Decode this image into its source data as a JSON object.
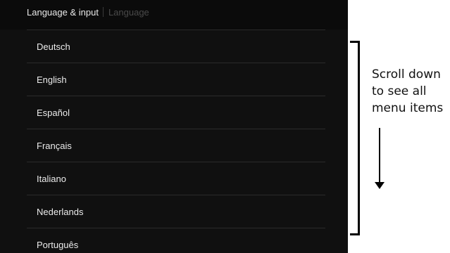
{
  "header": {
    "parent": "Language & input",
    "current": "Language"
  },
  "languages": [
    {
      "label": "Deutsch"
    },
    {
      "label": "English"
    },
    {
      "label": "Español"
    },
    {
      "label": "Français"
    },
    {
      "label": "Italiano"
    },
    {
      "label": "Nederlands"
    },
    {
      "label": "Português"
    }
  ],
  "annotation": {
    "lines": [
      "Scroll down",
      "to see all",
      "menu items"
    ],
    "arrow_icon": "down-arrow-icon"
  },
  "colors": {
    "screen_bg": "#101010",
    "text": "#ececec",
    "divider": "#2b2b2b",
    "annotation": "#000000"
  }
}
